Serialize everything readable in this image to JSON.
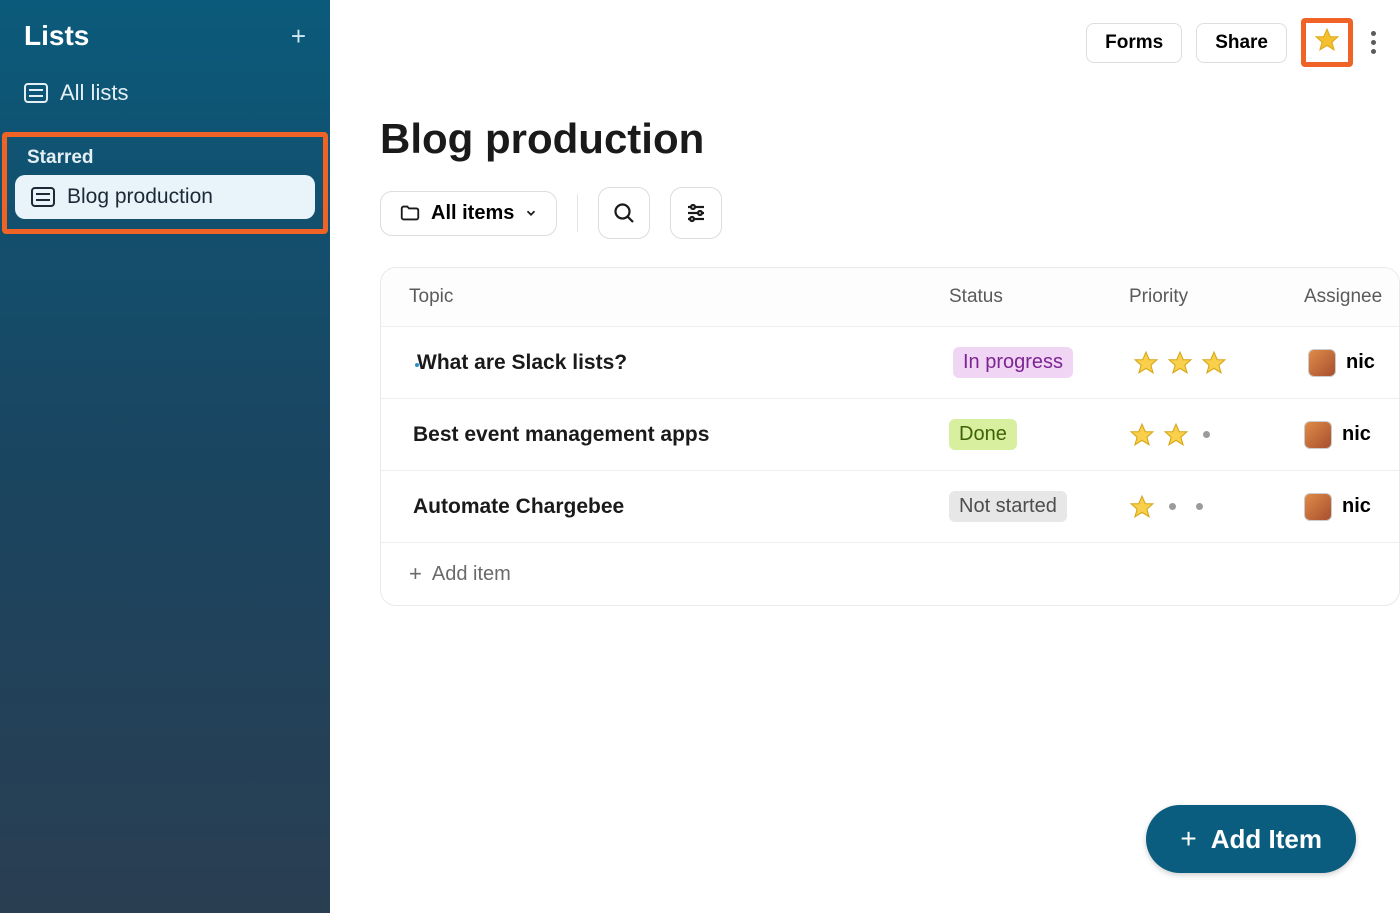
{
  "sidebar": {
    "title": "Lists",
    "all_lists": "All lists",
    "starred_label": "Starred",
    "starred_items": [
      {
        "label": "Blog production"
      }
    ]
  },
  "topbar": {
    "forms": "Forms",
    "share": "Share"
  },
  "page": {
    "title": "Blog production"
  },
  "filter": {
    "label": "All items"
  },
  "table": {
    "columns": {
      "topic": "Topic",
      "status": "Status",
      "priority": "Priority",
      "assignee": "Assignee"
    },
    "rows": [
      {
        "topic": "What are Slack lists?",
        "status": "In progress",
        "status_class": "status-inprogress",
        "stars": 3,
        "assignee": "nic",
        "active": true
      },
      {
        "topic": "Best event management apps",
        "status": "Done",
        "status_class": "status-done",
        "stars": 2,
        "assignee": "nic",
        "active": false
      },
      {
        "topic": "Automate Chargebee",
        "status": "Not started",
        "status_class": "status-notstarted",
        "stars": 1,
        "assignee": "nic",
        "active": false
      }
    ],
    "add_item": "Add item"
  },
  "fab": {
    "label": "Add Item"
  }
}
